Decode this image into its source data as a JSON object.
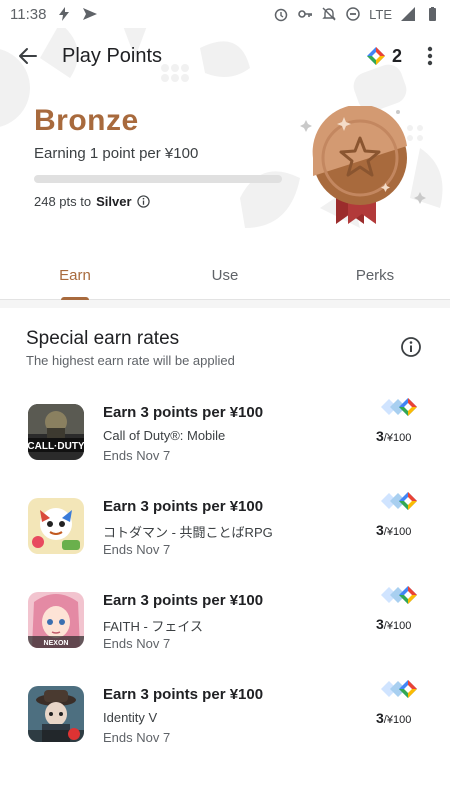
{
  "status_bar": {
    "time": "11:38",
    "network": "LTE"
  },
  "app_bar": {
    "title": "Play Points",
    "points": "2"
  },
  "tier": {
    "name": "Bronze",
    "earning": "Earning 1 point per ¥100",
    "progress_fraction": 0.0,
    "pts_to_next_prefix": "248 pts to",
    "next_tier": "Silver",
    "colors": {
      "bronze": "#a86a3d",
      "ribbon": "#9b2c2c"
    }
  },
  "tabs": [
    {
      "label": "Earn",
      "active": true
    },
    {
      "label": "Use",
      "active": false
    },
    {
      "label": "Perks",
      "active": false
    }
  ],
  "section": {
    "title": "Special earn rates",
    "subtitle": "The highest earn rate will be applied"
  },
  "offers": [
    {
      "title": "Earn 3 points per ¥100",
      "app": "Call of Duty®: Mobile",
      "ends": "Ends Nov 7",
      "rate_num": "3",
      "rate_unit": "/¥100",
      "icon": "call-of-duty-icon"
    },
    {
      "title": "Earn 3 points per ¥100",
      "app": "コトダマン - 共闘ことばRPG",
      "ends": "Ends Nov 7",
      "rate_num": "3",
      "rate_unit": "/¥100",
      "icon": "kotodaman-icon"
    },
    {
      "title": "Earn 3 points per ¥100",
      "app": "FAITH - フェイス",
      "ends": "Ends Nov 7",
      "rate_num": "3",
      "rate_unit": "/¥100",
      "icon": "faith-icon"
    },
    {
      "title": "Earn 3 points per ¥100",
      "app": "Identity V",
      "ends": "Ends Nov 7",
      "rate_num": "3",
      "rate_unit": "/¥100",
      "icon": "identity-v-icon"
    }
  ]
}
